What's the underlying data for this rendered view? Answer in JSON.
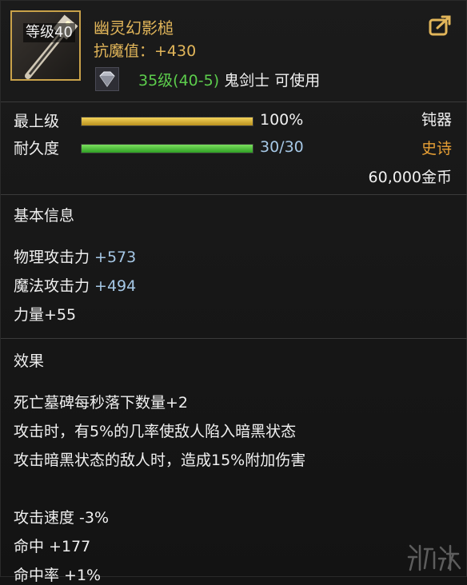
{
  "item": {
    "level_badge": "等级40",
    "name": "幽灵幻影槌",
    "resist": "抗魔值：+430",
    "requirement_level": "35级(40-5)",
    "requirement_class": " 鬼剑士 可使用"
  },
  "bars": {
    "top_label": "最上级",
    "top_value": "100%",
    "top_level": 1.0,
    "durability_label": "耐久度",
    "durability_value": "30/30",
    "durability_level": 1.0
  },
  "meta": {
    "type": "钝器",
    "rarity": "史诗",
    "price": "60,000金币"
  },
  "basic": {
    "title": "基本信息",
    "phys_label": "物理攻击力 ",
    "phys_value": "+573",
    "magic_label": "魔法攻击力 ",
    "magic_value": "+494",
    "str": "力量+55"
  },
  "effects": {
    "title": "效果",
    "lines": [
      "死亡墓碑每秒落下数量+2",
      "攻击时，有5%的几率使敌人陷入暗黑状态",
      "攻击暗黑状态的敌人时，造成15%附加伤害",
      "攻击速度 -3%",
      "命中 +177",
      "命中率 +1%"
    ]
  },
  "colors": {
    "name": "#e2b65a",
    "rarity": "#e8a035",
    "requirement": "#5ccd4c",
    "stat_value": "#a6c8e6",
    "frame": "#c9a24a"
  },
  "icons": {
    "weapon": "hammer-weapon-icon",
    "share": "share-arrow-icon",
    "gem": "diamond-gem-icon"
  }
}
